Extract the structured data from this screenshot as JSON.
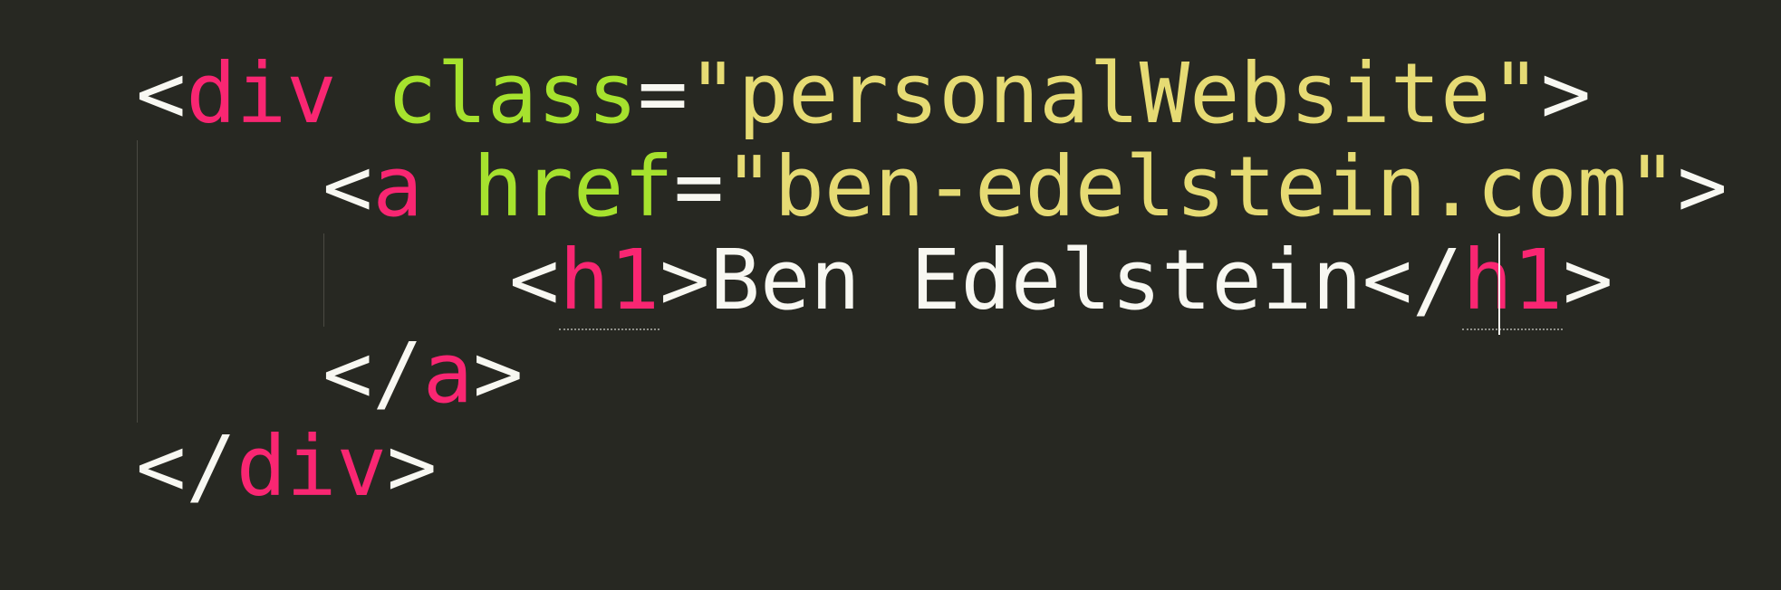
{
  "editor": {
    "theme_colors": {
      "background": "#272822",
      "tag": "#f92672",
      "attribute": "#a6e22e",
      "string": "#e6db74",
      "text": "#f8f8f2",
      "indent_guide": "#4a4a42"
    },
    "lines": [
      {
        "open": "<",
        "tag": "div",
        "attr": "class",
        "eq": "=",
        "value": "\"personalWebsite\"",
        "close": ">"
      },
      {
        "open": "<",
        "tag": "a",
        "attr": "href",
        "eq": "=",
        "value": "\"ben-edelstein.com\"",
        "close": ">"
      },
      {
        "open": "<",
        "tag": "h1",
        "close": ">",
        "text": "Ben Edelstein",
        "end_open": "</",
        "end_tag": "h1",
        "end_close": ">"
      },
      {
        "end_open": "</",
        "end_tag": "a",
        "end_close": ">"
      },
      {
        "end_open": "</",
        "end_tag": "div",
        "end_close": ">"
      }
    ]
  }
}
